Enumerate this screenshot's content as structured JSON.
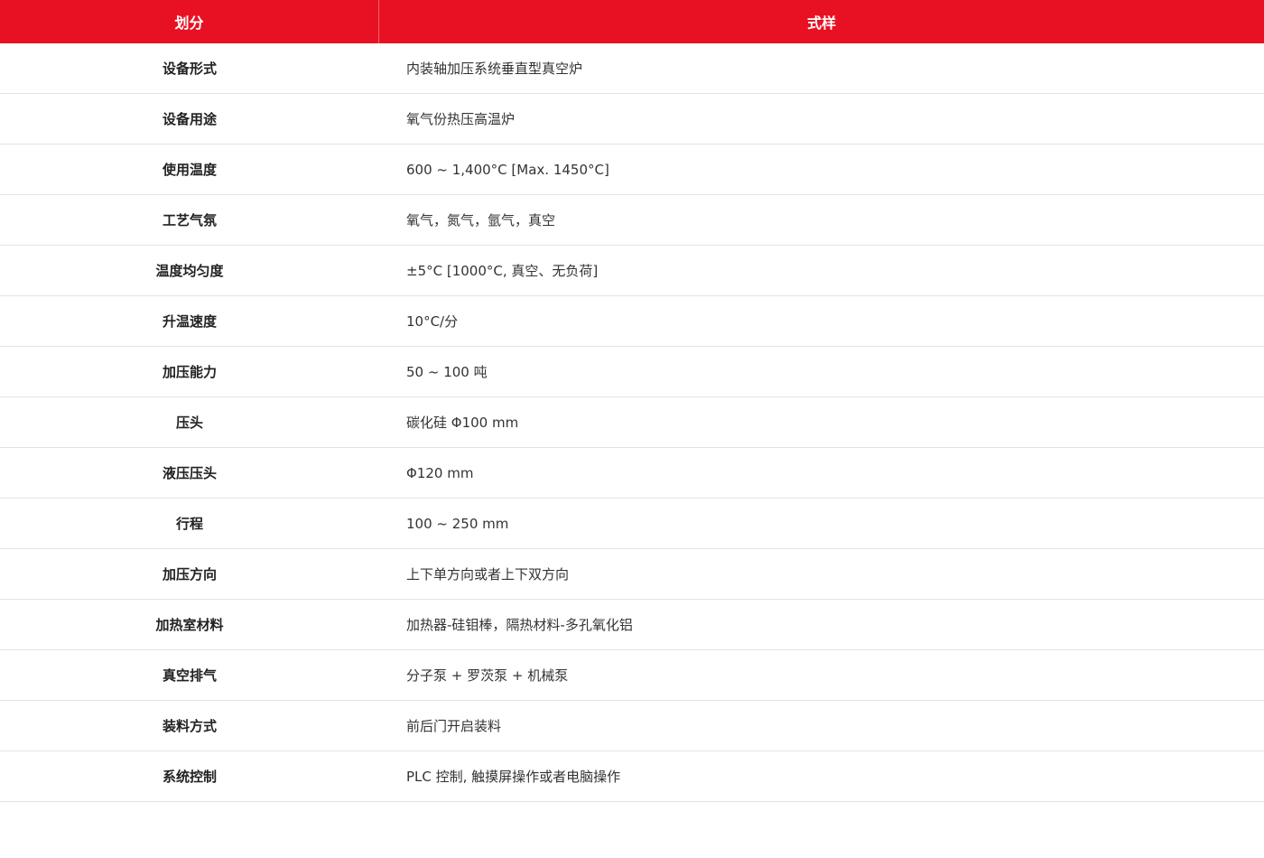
{
  "table": {
    "header": {
      "col1": "划分",
      "col2": "式样"
    },
    "rows": [
      {
        "label": "设备形式",
        "value": "内装轴加压系统垂直型真空炉"
      },
      {
        "label": "设备用途",
        "value": "氧气份热压高温炉"
      },
      {
        "label": "使用温度",
        "value": "600 ~ 1,400°C [Max. 1450°C]"
      },
      {
        "label": "工艺气氛",
        "value": "氧气，氮气，氩气，真空"
      },
      {
        "label": "温度均匀度",
        "value": "±5°C [1000°C, 真空、无负荷]"
      },
      {
        "label": "升温速度",
        "value": "10°C/分"
      },
      {
        "label": "加压能力",
        "value": "50 ~ 100 吨"
      },
      {
        "label": "压头",
        "value": "碳化硅 Φ100 mm"
      },
      {
        "label": "液压压头",
        "value": "Φ120 mm"
      },
      {
        "label": "行程",
        "value": "100 ~ 250 mm"
      },
      {
        "label": "加压方向",
        "value": "上下单方向或者上下双方向"
      },
      {
        "label": "加热室材料",
        "value": "加热器-硅钼棒，隔热材料-多孔氧化铝"
      },
      {
        "label": "真空排气",
        "value": "分子泵 + 罗茨泵 + 机械泵"
      },
      {
        "label": "装料方式",
        "value": "前后门开启装料"
      },
      {
        "label": "系统控制",
        "value": "PLC 控制, 触摸屏操作或者电脑操作"
      }
    ]
  },
  "colors": {
    "header_bg": "#e81123",
    "header_text": "#ffffff",
    "row_border": "#e3e3e3"
  }
}
